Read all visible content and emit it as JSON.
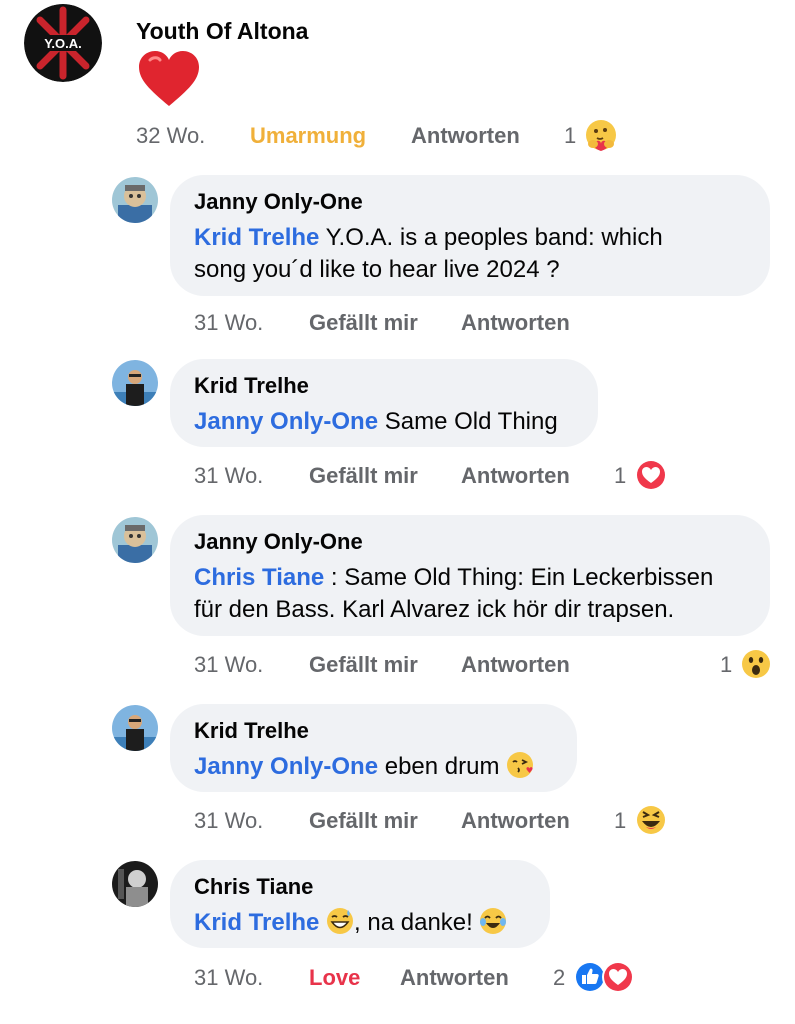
{
  "post": {
    "author": "Youth Of Altona",
    "avatar_text": "Y.O.A.",
    "reaction_icon": "red-heart",
    "time": "32 Wo.",
    "action_reaction": "Umarmung",
    "action_reply": "Antworten",
    "reaction_count": "1",
    "reaction_type": "care"
  },
  "comments": [
    {
      "author": "Janny Only-One",
      "mention": "Krid Trelhe",
      "text_line1": " Y.O.A. is a peoples band: which",
      "text_line2": "song you´d like to hear live 2024 ?",
      "time": "31 Wo.",
      "like": "Gefällt mir",
      "reply": "Antworten"
    },
    {
      "author": "Krid Trelhe",
      "mention": "Janny Only-One",
      "text": " Same Old Thing",
      "time": "31 Wo.",
      "like": "Gefällt mir",
      "reply": "Antworten",
      "reaction_count": "1",
      "reaction_type": "love"
    },
    {
      "author": "Janny Only-One",
      "mention": "Chris Tiane",
      "text_line1": " : Same Old Thing: Ein Leckerbissen",
      "text_line2": "für den Bass. Karl Alvarez ick hör dir trapsen.",
      "time": "31 Wo.",
      "like": "Gefällt mir",
      "reply": "Antworten",
      "reaction_count": "1",
      "reaction_type": "wow"
    },
    {
      "author": "Krid Trelhe",
      "mention": "Janny Only-One",
      "text": " eben drum ",
      "text_emoji": "kiss-face",
      "time": "31 Wo.",
      "like": "Gefällt mir",
      "reply": "Antworten",
      "reaction_count": "1",
      "reaction_type": "haha"
    },
    {
      "author": "Chris Tiane",
      "mention": "Krid Trelhe",
      "text_emoji1": "grin-sweat-face",
      "text": ", na danke! ",
      "text_emoji2": "tears-of-joy-face",
      "time": "31 Wo.",
      "like": "Love",
      "reply": "Antworten",
      "reaction_count": "2",
      "reaction_type": "like+love"
    }
  ],
  "colors": {
    "mention": "#2d6cdf",
    "bubble": "#f0f2f5",
    "meta": "#65676b",
    "care": "#f0b03a",
    "love": "#e8334a"
  }
}
